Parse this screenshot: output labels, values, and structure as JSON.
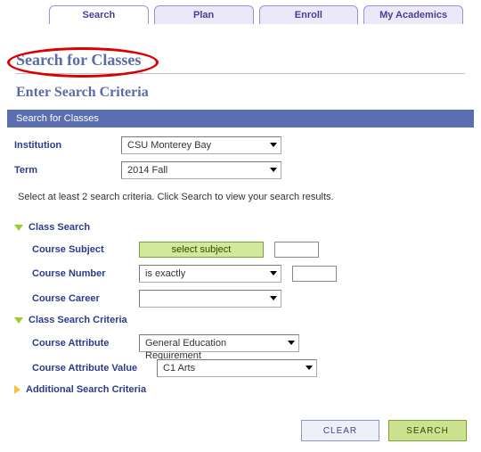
{
  "tabs": {
    "search": "Search",
    "plan": "Plan",
    "enroll": "Enroll",
    "academics": "My Academics"
  },
  "page_title": "Search for Classes",
  "subheading": "Enter Search Criteria",
  "section_bar": "Search for Classes",
  "base": {
    "institution_label": "Institution",
    "institution_value": "CSU Monterey Bay",
    "term_label": "Term",
    "term_value": "2014 Fall",
    "note": "Select at least 2 search criteria. Click Search to view your search results."
  },
  "sec1": {
    "title": "Class Search",
    "course_subject_label": "Course Subject",
    "select_subject_btn": "select subject",
    "subject_value": "",
    "course_number_label": "Course Number",
    "course_number_op": "is exactly",
    "course_number_value": "",
    "course_career_label": "Course Career",
    "course_career_value": ""
  },
  "sec2": {
    "title": "Class Search Criteria",
    "attr_label": "Course Attribute",
    "attr_value": "General Education Requirement",
    "attr_val_label": "Course Attribute Value",
    "attr_val_value": "C1 Arts"
  },
  "sec3": {
    "title": "Additional Search Criteria"
  },
  "buttons": {
    "clear": "Clear",
    "search": "Search"
  }
}
